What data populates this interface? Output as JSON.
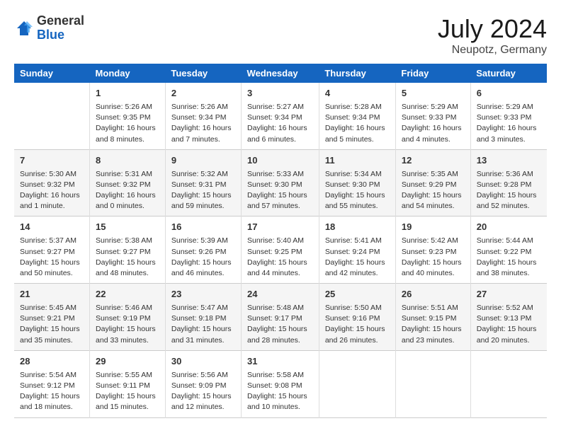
{
  "header": {
    "logo_line1": "General",
    "logo_line2": "Blue",
    "month": "July 2024",
    "location": "Neupotz, Germany"
  },
  "columns": [
    "Sunday",
    "Monday",
    "Tuesday",
    "Wednesday",
    "Thursday",
    "Friday",
    "Saturday"
  ],
  "weeks": [
    [
      {
        "day": "",
        "info": ""
      },
      {
        "day": "1",
        "info": "Sunrise: 5:26 AM\nSunset: 9:35 PM\nDaylight: 16 hours\nand 8 minutes."
      },
      {
        "day": "2",
        "info": "Sunrise: 5:26 AM\nSunset: 9:34 PM\nDaylight: 16 hours\nand 7 minutes."
      },
      {
        "day": "3",
        "info": "Sunrise: 5:27 AM\nSunset: 9:34 PM\nDaylight: 16 hours\nand 6 minutes."
      },
      {
        "day": "4",
        "info": "Sunrise: 5:28 AM\nSunset: 9:34 PM\nDaylight: 16 hours\nand 5 minutes."
      },
      {
        "day": "5",
        "info": "Sunrise: 5:29 AM\nSunset: 9:33 PM\nDaylight: 16 hours\nand 4 minutes."
      },
      {
        "day": "6",
        "info": "Sunrise: 5:29 AM\nSunset: 9:33 PM\nDaylight: 16 hours\nand 3 minutes."
      }
    ],
    [
      {
        "day": "7",
        "info": "Sunrise: 5:30 AM\nSunset: 9:32 PM\nDaylight: 16 hours\nand 1 minute."
      },
      {
        "day": "8",
        "info": "Sunrise: 5:31 AM\nSunset: 9:32 PM\nDaylight: 16 hours\nand 0 minutes."
      },
      {
        "day": "9",
        "info": "Sunrise: 5:32 AM\nSunset: 9:31 PM\nDaylight: 15 hours\nand 59 minutes."
      },
      {
        "day": "10",
        "info": "Sunrise: 5:33 AM\nSunset: 9:30 PM\nDaylight: 15 hours\nand 57 minutes."
      },
      {
        "day": "11",
        "info": "Sunrise: 5:34 AM\nSunset: 9:30 PM\nDaylight: 15 hours\nand 55 minutes."
      },
      {
        "day": "12",
        "info": "Sunrise: 5:35 AM\nSunset: 9:29 PM\nDaylight: 15 hours\nand 54 minutes."
      },
      {
        "day": "13",
        "info": "Sunrise: 5:36 AM\nSunset: 9:28 PM\nDaylight: 15 hours\nand 52 minutes."
      }
    ],
    [
      {
        "day": "14",
        "info": "Sunrise: 5:37 AM\nSunset: 9:27 PM\nDaylight: 15 hours\nand 50 minutes."
      },
      {
        "day": "15",
        "info": "Sunrise: 5:38 AM\nSunset: 9:27 PM\nDaylight: 15 hours\nand 48 minutes."
      },
      {
        "day": "16",
        "info": "Sunrise: 5:39 AM\nSunset: 9:26 PM\nDaylight: 15 hours\nand 46 minutes."
      },
      {
        "day": "17",
        "info": "Sunrise: 5:40 AM\nSunset: 9:25 PM\nDaylight: 15 hours\nand 44 minutes."
      },
      {
        "day": "18",
        "info": "Sunrise: 5:41 AM\nSunset: 9:24 PM\nDaylight: 15 hours\nand 42 minutes."
      },
      {
        "day": "19",
        "info": "Sunrise: 5:42 AM\nSunset: 9:23 PM\nDaylight: 15 hours\nand 40 minutes."
      },
      {
        "day": "20",
        "info": "Sunrise: 5:44 AM\nSunset: 9:22 PM\nDaylight: 15 hours\nand 38 minutes."
      }
    ],
    [
      {
        "day": "21",
        "info": "Sunrise: 5:45 AM\nSunset: 9:21 PM\nDaylight: 15 hours\nand 35 minutes."
      },
      {
        "day": "22",
        "info": "Sunrise: 5:46 AM\nSunset: 9:19 PM\nDaylight: 15 hours\nand 33 minutes."
      },
      {
        "day": "23",
        "info": "Sunrise: 5:47 AM\nSunset: 9:18 PM\nDaylight: 15 hours\nand 31 minutes."
      },
      {
        "day": "24",
        "info": "Sunrise: 5:48 AM\nSunset: 9:17 PM\nDaylight: 15 hours\nand 28 minutes."
      },
      {
        "day": "25",
        "info": "Sunrise: 5:50 AM\nSunset: 9:16 PM\nDaylight: 15 hours\nand 26 minutes."
      },
      {
        "day": "26",
        "info": "Sunrise: 5:51 AM\nSunset: 9:15 PM\nDaylight: 15 hours\nand 23 minutes."
      },
      {
        "day": "27",
        "info": "Sunrise: 5:52 AM\nSunset: 9:13 PM\nDaylight: 15 hours\nand 20 minutes."
      }
    ],
    [
      {
        "day": "28",
        "info": "Sunrise: 5:54 AM\nSunset: 9:12 PM\nDaylight: 15 hours\nand 18 minutes."
      },
      {
        "day": "29",
        "info": "Sunrise: 5:55 AM\nSunset: 9:11 PM\nDaylight: 15 hours\nand 15 minutes."
      },
      {
        "day": "30",
        "info": "Sunrise: 5:56 AM\nSunset: 9:09 PM\nDaylight: 15 hours\nand 12 minutes."
      },
      {
        "day": "31",
        "info": "Sunrise: 5:58 AM\nSunset: 9:08 PM\nDaylight: 15 hours\nand 10 minutes."
      },
      {
        "day": "",
        "info": ""
      },
      {
        "day": "",
        "info": ""
      },
      {
        "day": "",
        "info": ""
      }
    ]
  ]
}
